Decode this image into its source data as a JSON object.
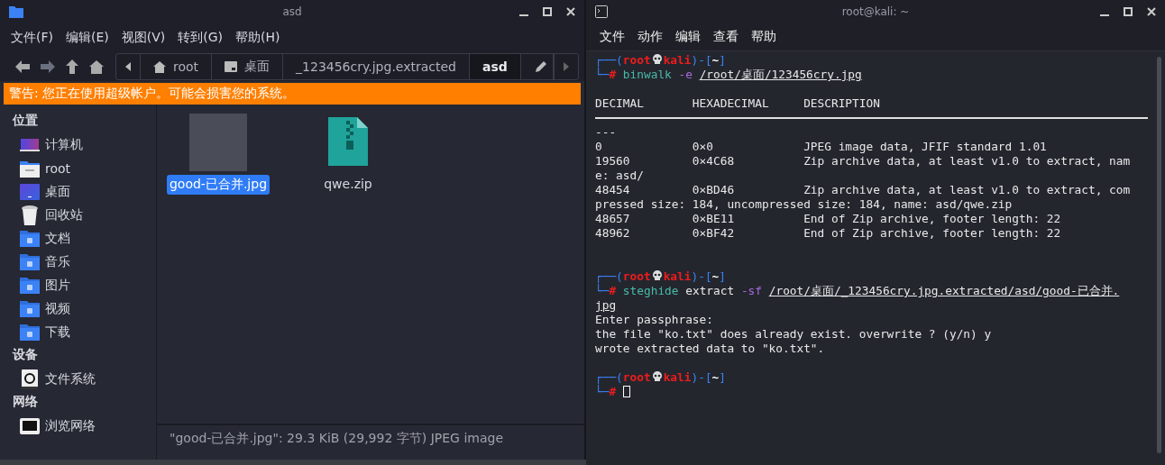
{
  "file_manager": {
    "title": "asd",
    "menu": [
      "文件(F)",
      "编辑(E)",
      "视图(V)",
      "转到(G)",
      "帮助(H)"
    ],
    "breadcrumb": [
      {
        "label": "root",
        "selected": false
      },
      {
        "label": "桌面",
        "selected": false
      },
      {
        "label": "_123456cry.jpg.extracted",
        "selected": false
      },
      {
        "label": "asd",
        "selected": true
      }
    ],
    "warning": "警告: 您正在使用超级帐户。可能会损害您的系统。",
    "sidebar": [
      {
        "heading": "位置",
        "items": [
          {
            "label": "计算机",
            "kind": "computer"
          },
          {
            "label": "root",
            "kind": "home"
          },
          {
            "label": "桌面",
            "kind": "desktop"
          },
          {
            "label": "回收站",
            "kind": "trash"
          },
          {
            "label": "文档",
            "kind": "folder"
          },
          {
            "label": "音乐",
            "kind": "folder"
          },
          {
            "label": "图片",
            "kind": "folder"
          },
          {
            "label": "视频",
            "kind": "folder"
          },
          {
            "label": "下载",
            "kind": "folder"
          }
        ]
      },
      {
        "heading": "设备",
        "items": [
          {
            "label": "文件系统",
            "kind": "drive"
          }
        ]
      },
      {
        "heading": "网络",
        "items": [
          {
            "label": "浏览网络",
            "kind": "network"
          }
        ]
      }
    ],
    "files": [
      {
        "name": "good-已合并.jpg",
        "kind": "image",
        "selected": true
      },
      {
        "name": "qwe.zip",
        "kind": "zip",
        "selected": false
      }
    ],
    "status_bar": "\"good-已合并.jpg\": 29.3 KiB (29,992 字节) JPEG image"
  },
  "terminal": {
    "title": "root@kali: ~",
    "menu": [
      "文件",
      "动作",
      "编辑",
      "查看",
      "帮助"
    ],
    "lines": [
      {
        "kind": "prompt",
        "open": "┌──(",
        "user": "root",
        "host": "kali",
        "sep": ")-[",
        "cwd": "~",
        "close": "]",
        "corner": "└─",
        "hash": "#",
        "cursor": false,
        "command": [
          {
            "kind": "tool",
            "text": "binwalk"
          },
          {
            "kind": "flag",
            "text": "-e"
          },
          {
            "kind": "path",
            "text": "/root/桌面/123456cry.jpg"
          }
        ]
      },
      {
        "kind": "blank"
      },
      {
        "kind": "output",
        "text": "DECIMAL       HEXADECIMAL     DESCRIPTION"
      },
      {
        "kind": "rule"
      },
      {
        "kind": "output",
        "text": "---"
      },
      {
        "kind": "output",
        "text": "0             0×0             JPEG image data, JFIF standard 1.01"
      },
      {
        "kind": "output",
        "text": "19560         0×4C68          Zip archive data, at least v1.0 to extract, nam"
      },
      {
        "kind": "output",
        "text": "e: asd/"
      },
      {
        "kind": "output",
        "text": "48454         0×BD46          Zip archive data, at least v1.0 to extract, com"
      },
      {
        "kind": "output",
        "text": "pressed size: 184, uncompressed size: 184, name: asd/qwe.zip"
      },
      {
        "kind": "output",
        "text": "48657         0×BE11          End of Zip archive, footer length: 22"
      },
      {
        "kind": "output",
        "text": "48962         0×BF42          End of Zip archive, footer length: 22"
      },
      {
        "kind": "blank"
      },
      {
        "kind": "blank"
      },
      {
        "kind": "prompt",
        "open": "┌──(",
        "user": "root",
        "host": "kali",
        "sep": ")-[",
        "cwd": "~",
        "close": "]",
        "corner": "└─",
        "hash": "#",
        "cursor": false,
        "command": [
          {
            "kind": "tool",
            "text": "steghide"
          },
          {
            "kind": "arg",
            "text": "extract"
          },
          {
            "kind": "flag",
            "text": "-sf"
          },
          {
            "kind": "path",
            "text": "/root/桌面/_123456cry.jpg.extracted/asd/good-已合并."
          }
        ]
      },
      {
        "kind": "path",
        "text": "jpg"
      },
      {
        "kind": "output",
        "text": "Enter passphrase:"
      },
      {
        "kind": "output",
        "text": "the file \"ko.txt\" does already exist. overwrite ? (y/n) y"
      },
      {
        "kind": "output",
        "text": "wrote extracted data to \"ko.txt\"."
      },
      {
        "kind": "blank"
      },
      {
        "kind": "prompt",
        "open": "┌──(",
        "user": "root",
        "host": "kali",
        "sep": ")-[",
        "cwd": "~",
        "close": "]",
        "corner": "└─",
        "hash": "#",
        "cursor": true
      }
    ]
  }
}
